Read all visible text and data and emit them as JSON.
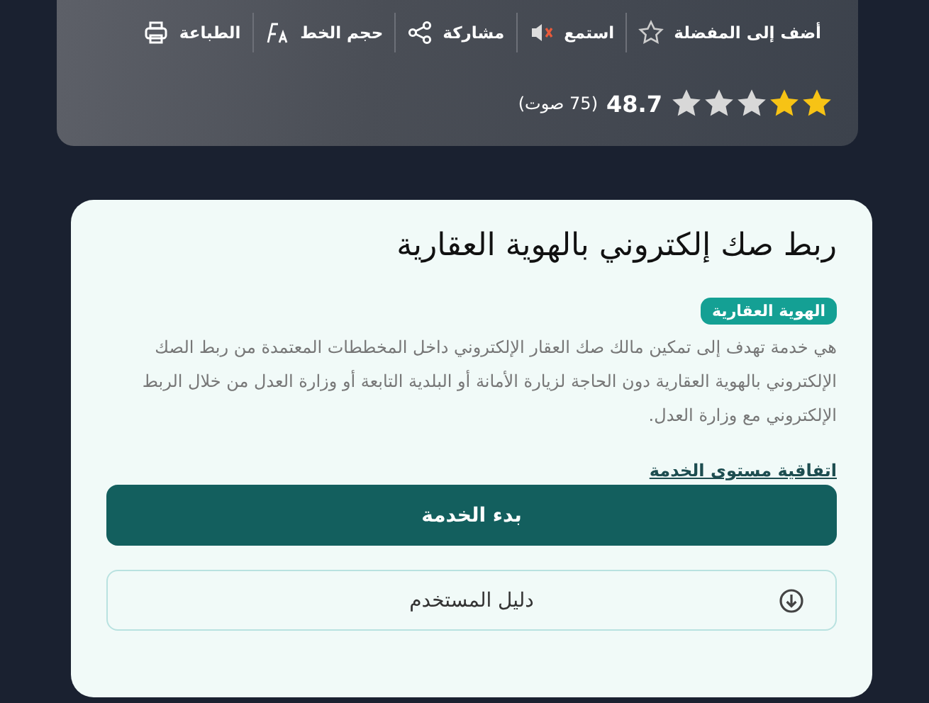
{
  "toolbar": {
    "actions": [
      {
        "kind": "favorite",
        "label": "أضف إلى المفضلة"
      },
      {
        "kind": "listen",
        "label": "استمع"
      },
      {
        "kind": "share",
        "label": "مشاركة"
      },
      {
        "kind": "font-size",
        "label": "حجم الخط"
      },
      {
        "kind": "print",
        "label": "الطباعة"
      }
    ]
  },
  "rating": {
    "stars": 2,
    "score": "48.7",
    "votes": "(75 صوت)"
  },
  "service": {
    "title": "ربط صك إلكتروني بالهوية العقارية",
    "tag": "الهوية العقارية",
    "description": "هي خدمة تهدف إلى تمكين مالك صك العقار الإلكتروني داخل المخططات المعتمدة من ربط الصك الإلكتروني بالهوية العقارية دون الحاجة لزيارة الأمانة أو البلدية التابعة أو وزارة العدل من خلال الربط الإلكتروني مع وزارة العدل.",
    "sla_link": "اتفاقية مستوى الخدمة",
    "start_button": "بدء الخدمة",
    "guide_button": "دليل المستخدم"
  }
}
